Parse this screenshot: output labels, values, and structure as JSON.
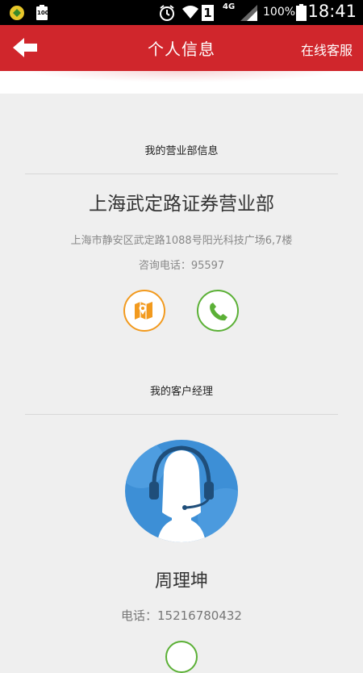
{
  "status_bar": {
    "left_badge": "100",
    "network": "4G",
    "sim_slot": "1",
    "battery": "100%",
    "time": "18:41"
  },
  "header": {
    "title": "个人信息",
    "service_label": "在线客服"
  },
  "branch": {
    "section_title": "我的营业部信息",
    "name": "上海武定路证券营业部",
    "address": "上海市静安区武定路1088号阳光科技广场6,7楼",
    "phone_text": "咨询电话：95597"
  },
  "manager": {
    "section_title": "我的客户经理",
    "name": "周理坤",
    "phone_text": "电话：15216780432"
  },
  "colors": {
    "header_red": "#d0262c",
    "map_orange": "#f29a1e",
    "call_green": "#5bb036",
    "avatar_blue": "#3d8fd6"
  },
  "icons": {
    "back": "arrow-left-icon",
    "map": "map-pin-icon",
    "call": "phone-icon",
    "avatar": "headset-agent-icon"
  }
}
